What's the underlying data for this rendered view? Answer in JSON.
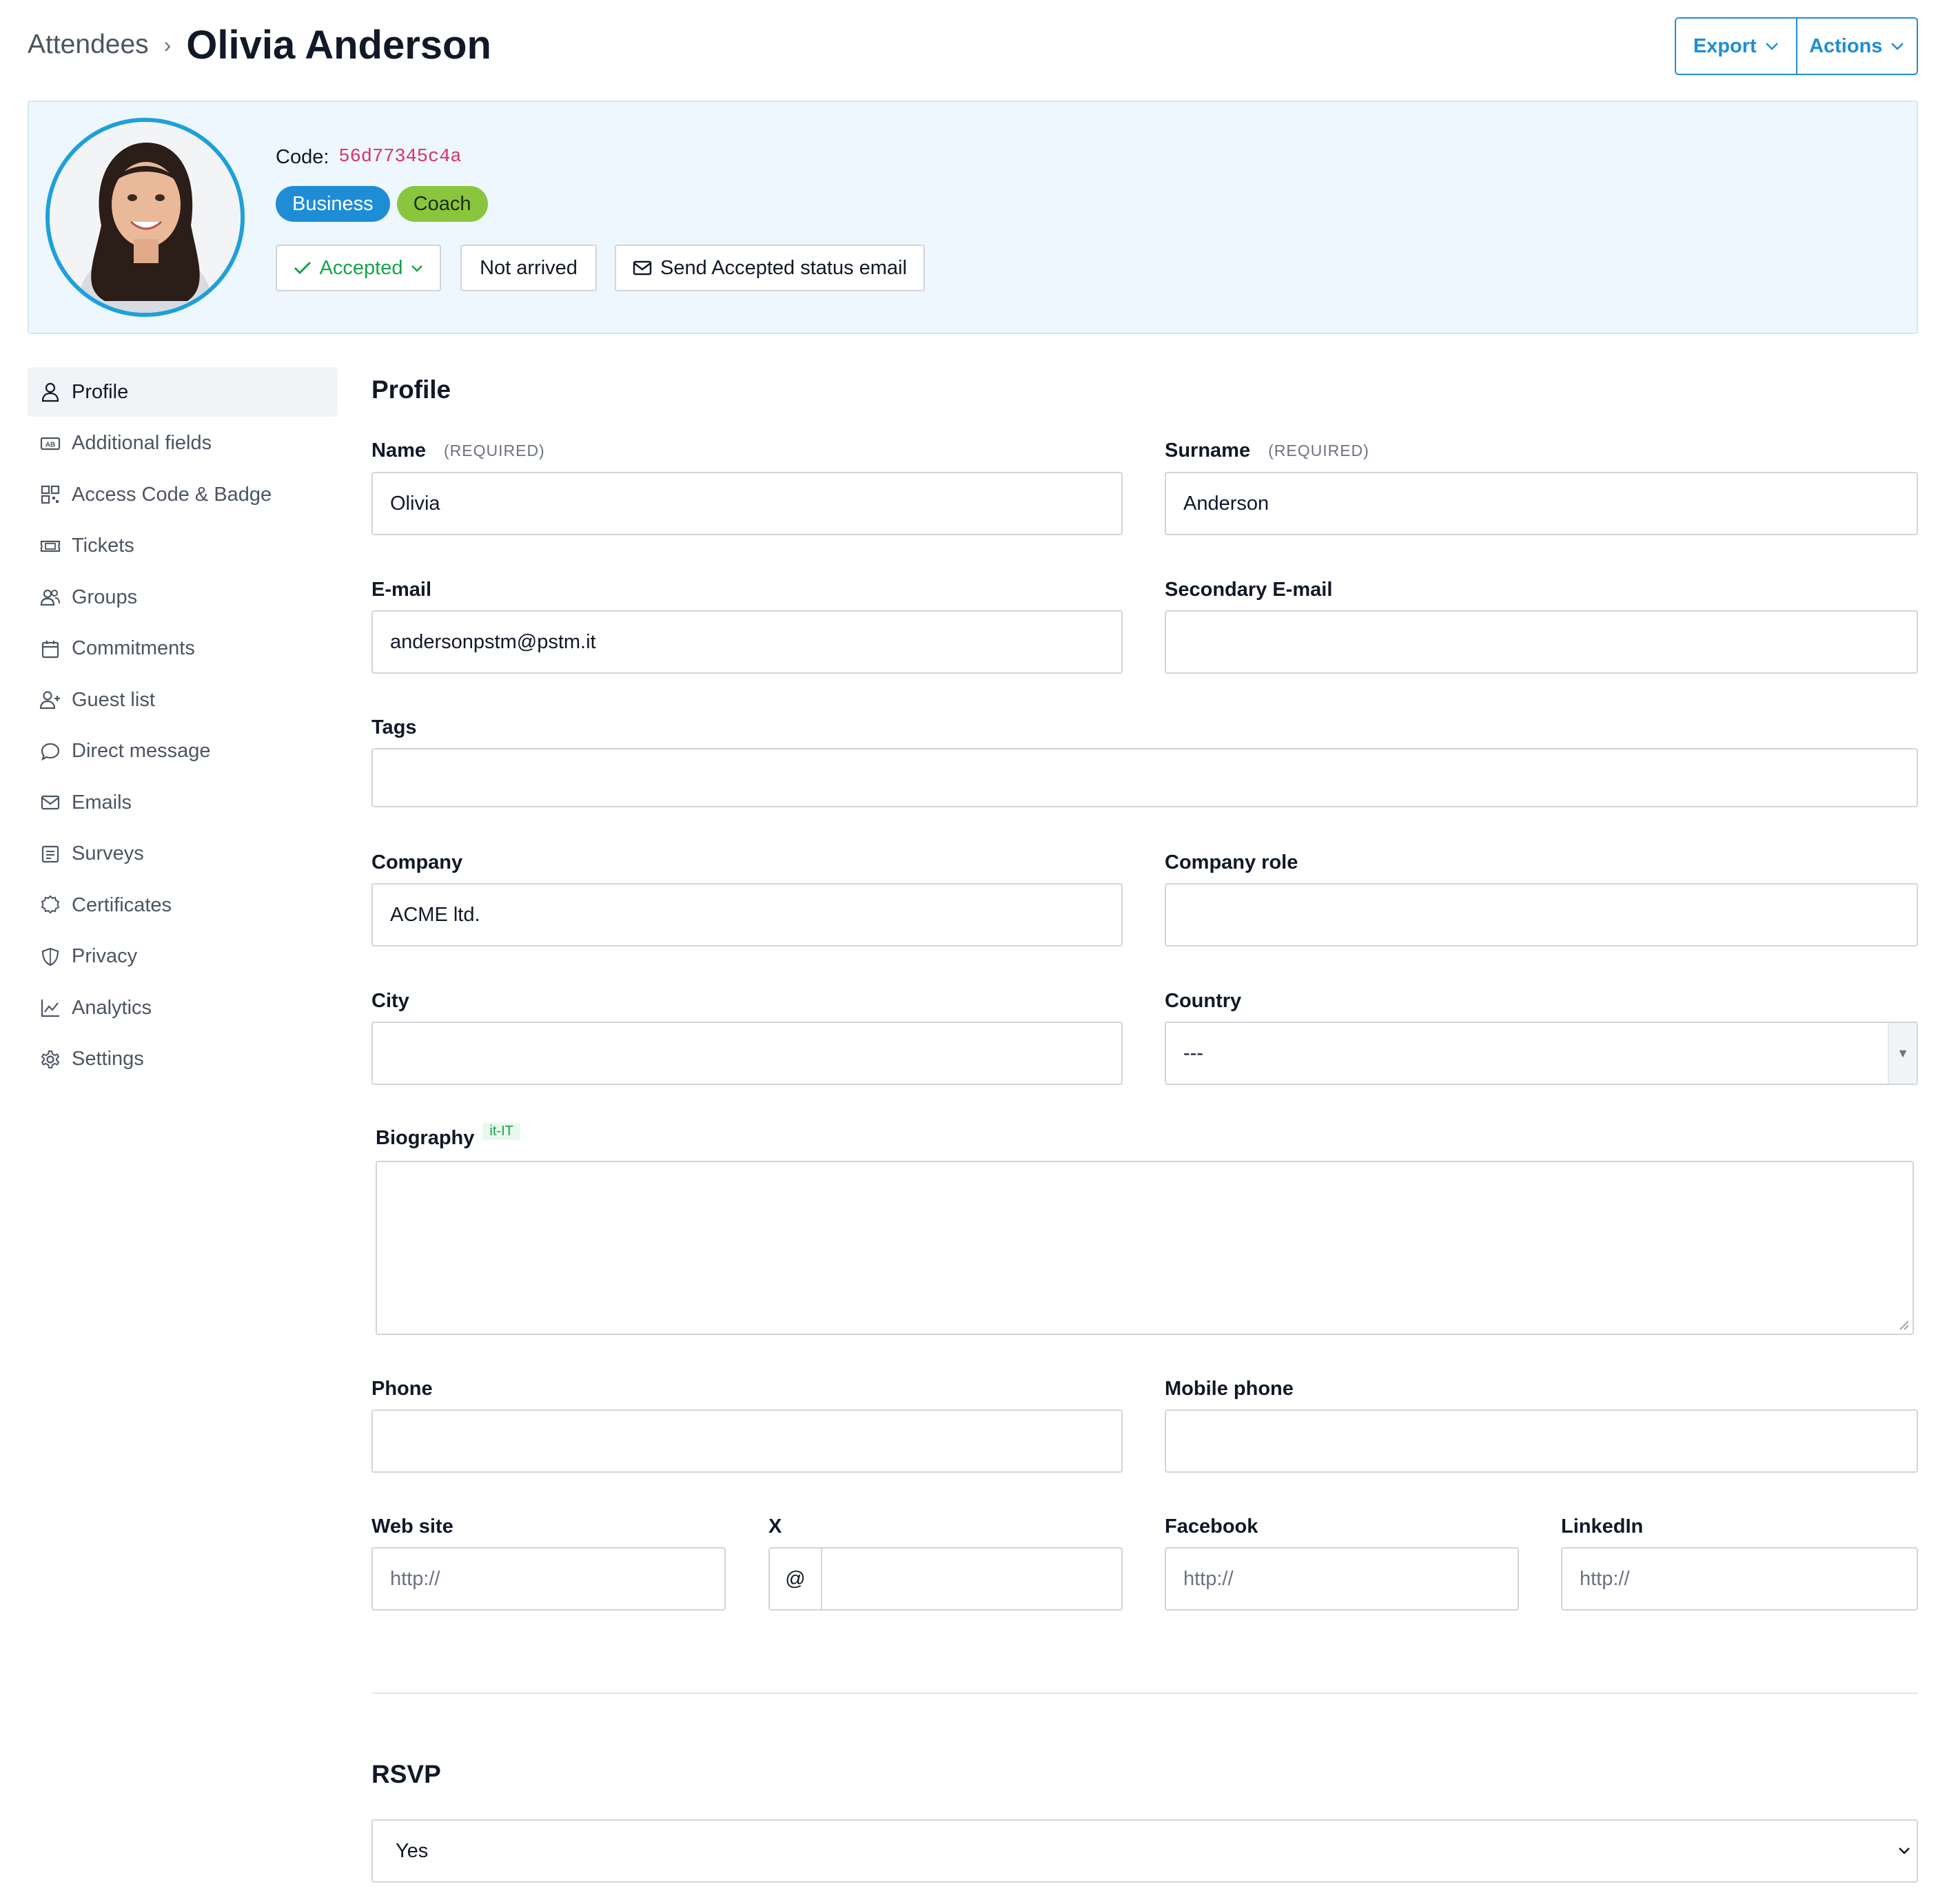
{
  "header": {
    "breadcrumb_parent": "Attendees",
    "breadcrumb_separator": "›",
    "title": "Olivia Anderson",
    "export_label": "Export",
    "actions_label": "Actions"
  },
  "banner": {
    "code_label": "Code:",
    "code_value": "56d77345c4a",
    "badges": [
      "Business",
      "Coach"
    ],
    "status_label": "Accepted",
    "arrival_label": "Not arrived",
    "send_email_label": "Send Accepted status email"
  },
  "sidebar": {
    "items": [
      {
        "label": "Profile",
        "icon": "user-icon",
        "active": true
      },
      {
        "label": "Additional fields",
        "icon": "ab-field-icon"
      },
      {
        "label": "Access Code & Badge",
        "icon": "qr-code-icon"
      },
      {
        "label": "Tickets",
        "icon": "ticket-icon"
      },
      {
        "label": "Groups",
        "icon": "users-icon"
      },
      {
        "label": "Commitments",
        "icon": "calendar-icon"
      },
      {
        "label": "Guest list",
        "icon": "user-plus-icon"
      },
      {
        "label": "Direct message",
        "icon": "chat-bubble-icon"
      },
      {
        "label": "Emails",
        "icon": "envelope-icon"
      },
      {
        "label": "Surveys",
        "icon": "survey-icon"
      },
      {
        "label": "Certificates",
        "icon": "certificate-icon"
      },
      {
        "label": "Privacy",
        "icon": "shield-icon"
      },
      {
        "label": "Analytics",
        "icon": "chart-line-icon"
      },
      {
        "label": "Settings",
        "icon": "gear-icon"
      }
    ]
  },
  "profile": {
    "section_title": "Profile",
    "required_tag": "(REQUIRED)",
    "name": {
      "label": "Name",
      "value": "Olivia"
    },
    "surname": {
      "label": "Surname",
      "value": "Anderson"
    },
    "email": {
      "label": "E-mail",
      "value": "andersonpstm@pstm.it"
    },
    "secondary_email": {
      "label": "Secondary E-mail",
      "value": ""
    },
    "tags": {
      "label": "Tags",
      "value": ""
    },
    "company": {
      "label": "Company",
      "value": "ACME ltd."
    },
    "company_role": {
      "label": "Company role",
      "value": ""
    },
    "city": {
      "label": "City",
      "value": ""
    },
    "country": {
      "label": "Country",
      "value": "---"
    },
    "biography": {
      "label": "Biography",
      "locale": "it-IT",
      "value": ""
    },
    "phone": {
      "label": "Phone",
      "value": ""
    },
    "mobile_phone": {
      "label": "Mobile phone",
      "value": ""
    },
    "website": {
      "label": "Web site",
      "placeholder": "http://"
    },
    "x": {
      "label": "X",
      "prefix": "@",
      "value": ""
    },
    "facebook": {
      "label": "Facebook",
      "placeholder": "http://"
    },
    "linkedin": {
      "label": "LinkedIn",
      "placeholder": "http://"
    }
  },
  "rsvp": {
    "section_title": "RSVP",
    "value": "Yes"
  },
  "colors": {
    "accent": "#1f8dd6",
    "success": "#16a34a",
    "code": "#d6336c",
    "coach_badge": "#8ac53e",
    "banner_bg": "#eef7fd"
  }
}
